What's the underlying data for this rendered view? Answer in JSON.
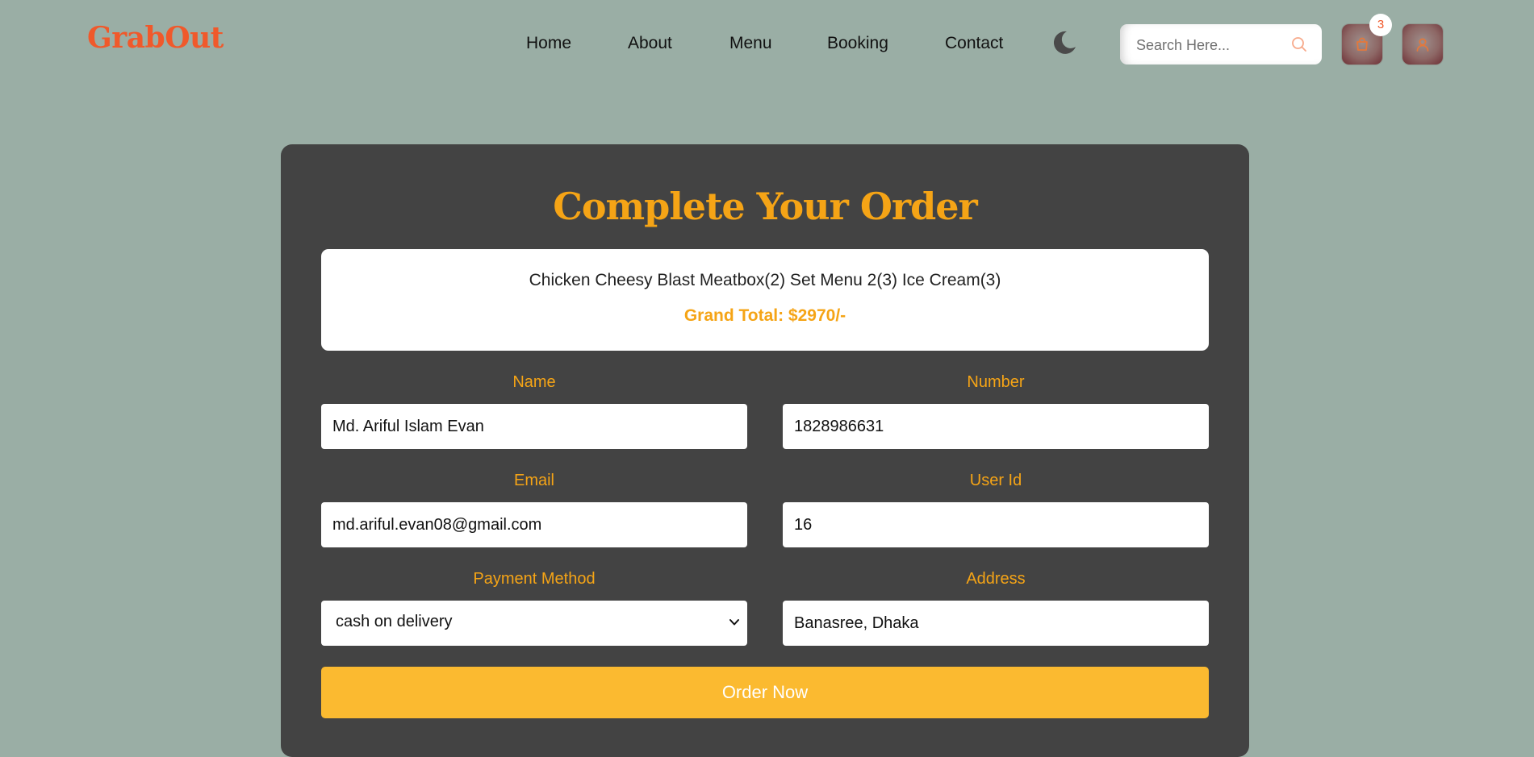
{
  "header": {
    "logo": "GrabOut",
    "nav": [
      {
        "label": "Home"
      },
      {
        "label": "About"
      },
      {
        "label": "Menu"
      },
      {
        "label": "Booking"
      },
      {
        "label": "Contact"
      }
    ],
    "search": {
      "placeholder": "Search Here..."
    },
    "cart_count": "3",
    "icons": {
      "theme_toggle": "moon-icon",
      "search": "search-icon",
      "cart": "shopping-bag-icon",
      "user": "user-icon"
    }
  },
  "order": {
    "title": "Complete Your Order",
    "items_summary": "Chicken Cheesy Blast Meatbox(2) Set Menu 2(3) Ice Cream(3)",
    "grand_total": "Grand Total: $2970/-",
    "fields": {
      "name": {
        "label": "Name",
        "value": "Md. Ariful Islam Evan"
      },
      "number": {
        "label": "Number",
        "value": "1828986631"
      },
      "email": {
        "label": "Email",
        "value": "md.ariful.evan08@gmail.com"
      },
      "user_id": {
        "label": "User Id",
        "value": "16"
      },
      "payment_method": {
        "label": "Payment Method",
        "value": "cash on delivery"
      },
      "address": {
        "label": "Address",
        "value": "Banasree, Dhaka"
      }
    },
    "submit_label": "Order Now"
  },
  "colors": {
    "background": "#9aaea5",
    "brand": "#f0592b",
    "accent": "#f5a416",
    "card": "#434343",
    "button": "#fbba30"
  }
}
